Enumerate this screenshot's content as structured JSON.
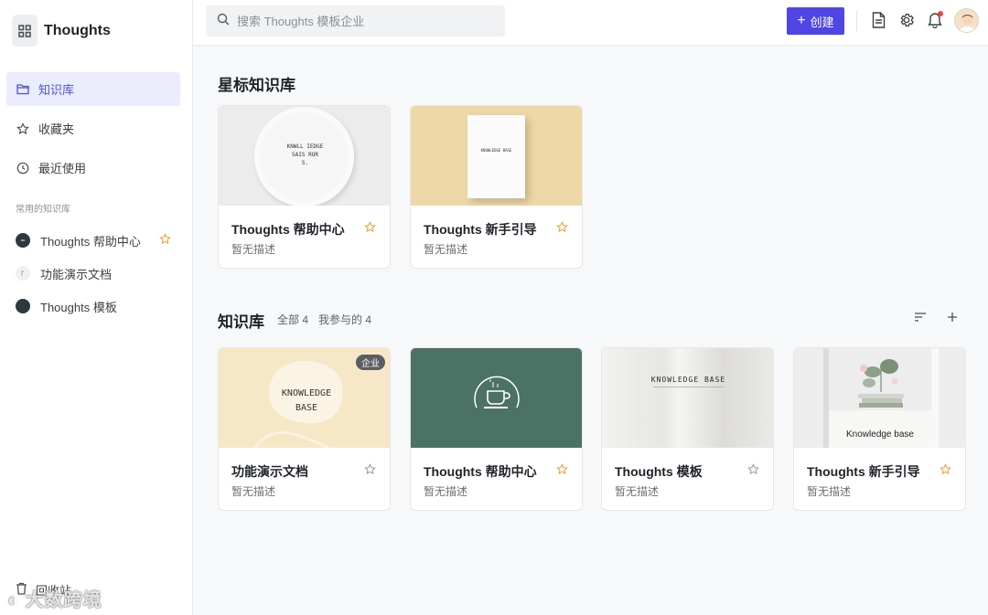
{
  "sidebar": {
    "brand": "Thoughts",
    "nav": [
      {
        "label": "知识库",
        "icon": "folder-icon",
        "active": true
      },
      {
        "label": "收藏夹",
        "icon": "star-icon",
        "active": false
      },
      {
        "label": "最近使用",
        "icon": "clock-icon",
        "active": false
      }
    ],
    "section_label": "常用的知识库",
    "libraries": [
      {
        "label": "Thoughts 帮助中心",
        "starred": true
      },
      {
        "label": "功能演示文档",
        "starred": false
      },
      {
        "label": "Thoughts 模板",
        "starred": false
      }
    ],
    "trash_label": "回收站",
    "watermark": "大数跨境"
  },
  "header": {
    "search_placeholder": "搜索 Thoughts 模板企业",
    "create_label": "创建"
  },
  "starred": {
    "title": "星标知识库",
    "cards": [
      {
        "title": "Thoughts 帮助中心",
        "desc": "暂无描述",
        "starred": true,
        "cover_text": [
          "KNWLL IEDGE",
          "SAIS ROR",
          "S."
        ]
      },
      {
        "title": "Thoughts 新手引导",
        "desc": "暂无描述",
        "starred": true,
        "cover_text": [
          "KNOWLEDGE BASE"
        ]
      }
    ]
  },
  "knowledge": {
    "title": "知识库",
    "filter_all": "全部 4",
    "filter_mine": "我参与的 4",
    "cards": [
      {
        "title": "功能演示文档",
        "desc": "暂无描述",
        "starred": false,
        "badge": "企业",
        "cover_text": [
          "KNOWLEDGE",
          "BASE"
        ]
      },
      {
        "title": "Thoughts 帮助中心",
        "desc": "暂无描述",
        "starred": true
      },
      {
        "title": "Thoughts 模板",
        "desc": "暂无描述",
        "starred": false,
        "cover_text": [
          "KNOWLEDGE BASE"
        ]
      },
      {
        "title": "Thoughts 新手引导",
        "desc": "暂无描述",
        "starred": true,
        "cover_text": [
          "Knowledge base"
        ]
      }
    ]
  },
  "colors": {
    "accent": "#4f46e5",
    "star_active": "#e8a33c",
    "star_inactive": "#9aa0a6"
  }
}
